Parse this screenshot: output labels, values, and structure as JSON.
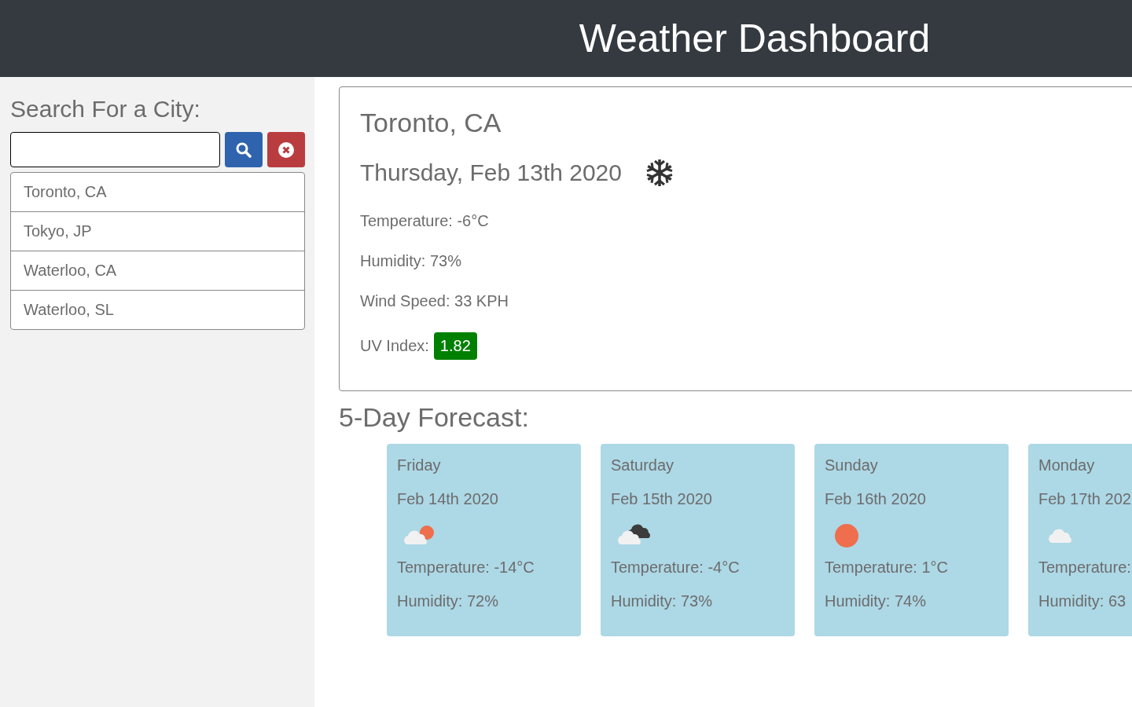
{
  "header": {
    "title": "Weather Dashboard"
  },
  "sidebar": {
    "heading": "Search For a City:",
    "history": [
      {
        "label": "Toronto, CA"
      },
      {
        "label": "Tokyo, JP"
      },
      {
        "label": "Waterloo, CA"
      },
      {
        "label": "Waterloo, SL"
      }
    ]
  },
  "current": {
    "city": "Toronto, CA",
    "date": "Thursday, Feb 13th 2020",
    "kind": "snow",
    "temperature": "Temperature: -6°C",
    "humidity": "Humidity: 73%",
    "wind": "Wind Speed: 33 KPH",
    "uv_label": "UV Index:",
    "uv_value": "1.82"
  },
  "forecast": {
    "heading": "5-Day Forecast:",
    "days": [
      {
        "day": "Friday",
        "date": "Feb 14th 2020",
        "kind": "partly-cloudy",
        "temperature": "Temperature: -14°C",
        "humidity": "Humidity: 72%"
      },
      {
        "day": "Saturday",
        "date": "Feb 15th 2020",
        "kind": "overcast",
        "temperature": "Temperature: -4°C",
        "humidity": "Humidity: 73%"
      },
      {
        "day": "Sunday",
        "date": "Feb 16th 2020",
        "kind": "clear",
        "temperature": "Temperature: 1°C",
        "humidity": "Humidity: 74%"
      },
      {
        "day": "Monday",
        "date": "Feb 17th 202",
        "kind": "cloudy",
        "temperature": "Temperature:",
        "humidity": "Humidity: 63"
      }
    ]
  }
}
